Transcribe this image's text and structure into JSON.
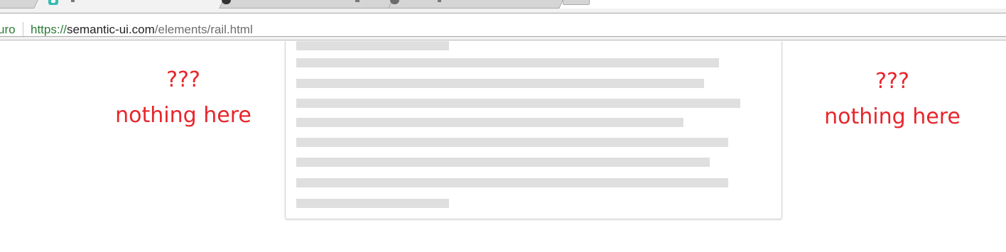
{
  "browser": {
    "tabs": [
      {
        "id": "previous-tab",
        "active": false
      },
      {
        "id": "semantic-rail-tab",
        "active": true,
        "favicon": "semantic-ui-icon"
      },
      {
        "id": "github-tab",
        "active": false,
        "favicon": "github-icon"
      },
      {
        "id": "settings-tab",
        "active": false,
        "favicon": "gear-icon"
      }
    ],
    "omnibox_chip": "uro",
    "url": {
      "scheme": "https://",
      "host": "semantic-ui.com",
      "path": "/elements/rail.html"
    }
  },
  "page": {
    "segment": {
      "placeholder_line_color": "#dfdfe0",
      "placeholder_lines": 9
    },
    "left_rail": {
      "question": "???",
      "note": "nothing here"
    },
    "right_rail": {
      "question": "???",
      "note": "nothing here"
    },
    "annotation_color": "#e8252c"
  }
}
